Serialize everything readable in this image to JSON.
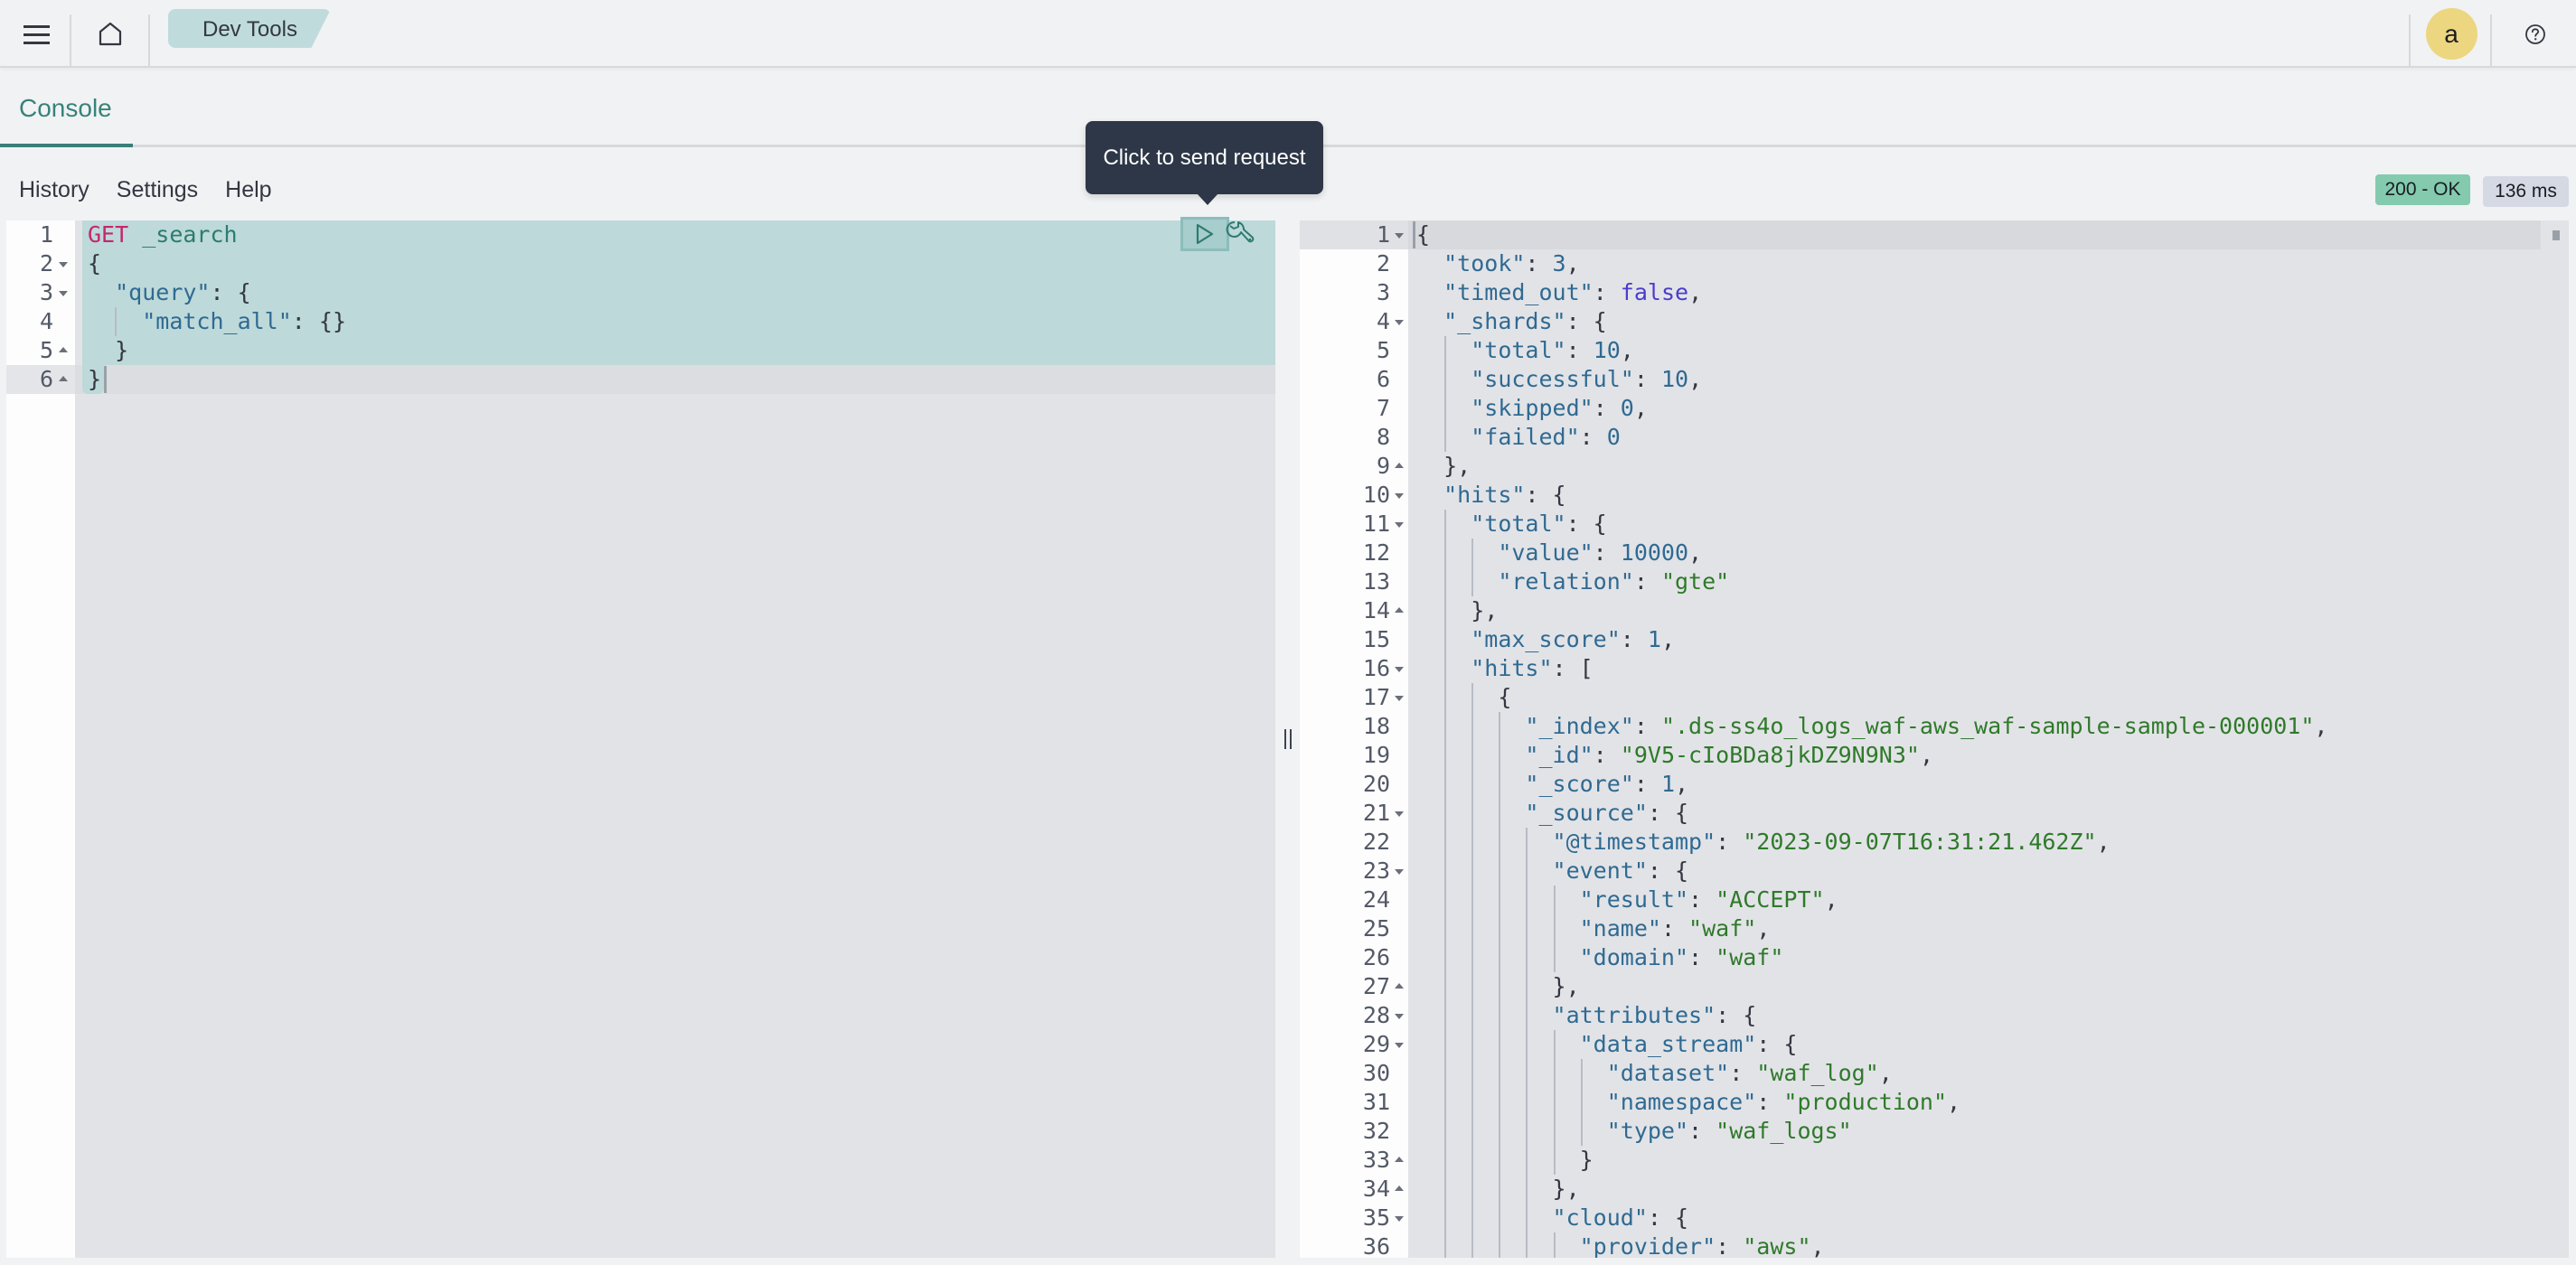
{
  "header": {
    "menu_icon": "hamburger-menu-icon",
    "home_icon": "home-icon",
    "breadcrumb": "Dev Tools",
    "avatar_initial": "a",
    "help_icon": "question-circle-icon"
  },
  "tabs": [
    {
      "label": "Console",
      "active": true
    }
  ],
  "toolbar": {
    "history": "History",
    "settings": "Settings",
    "help": "Help"
  },
  "response_status": {
    "status": "200 - OK",
    "status_color": "#83caaf",
    "time": "136 ms"
  },
  "tooltip": {
    "text": "Click to send request"
  },
  "request_actions": {
    "send_icon": "play-icon",
    "settings_icon": "wrench-icon"
  },
  "request_editor": {
    "active_line": 6,
    "lines": [
      {
        "n": "1",
        "fold": "",
        "indent": 0,
        "tokens": [
          [
            "kw",
            "GET"
          ],
          [
            "punc",
            " "
          ],
          [
            "path",
            "_search"
          ]
        ]
      },
      {
        "n": "2",
        "fold": "down",
        "indent": 0,
        "tokens": [
          [
            "punc",
            "{"
          ]
        ]
      },
      {
        "n": "3",
        "fold": "down",
        "indent": 1,
        "tokens": [
          [
            "key",
            "\"query\""
          ],
          [
            "punc",
            ": {"
          ]
        ]
      },
      {
        "n": "4",
        "fold": "",
        "indent": 2,
        "tokens": [
          [
            "key",
            "\"match_all\""
          ],
          [
            "punc",
            ": {}"
          ]
        ]
      },
      {
        "n": "5",
        "fold": "up",
        "indent": 1,
        "tokens": [
          [
            "punc",
            "}"
          ]
        ]
      },
      {
        "n": "6",
        "fold": "up",
        "indent": 0,
        "tokens": [
          [
            "punc",
            "}"
          ]
        ]
      }
    ]
  },
  "response_output": {
    "active_line": 1,
    "lines": [
      {
        "n": "1",
        "fold": "down",
        "indent": 0,
        "tokens": [
          [
            "punc",
            "{"
          ]
        ]
      },
      {
        "n": "2",
        "fold": "",
        "indent": 1,
        "tokens": [
          [
            "key",
            "\"took\""
          ],
          [
            "punc",
            ": "
          ],
          [
            "num",
            "3"
          ],
          [
            "punc",
            ","
          ]
        ]
      },
      {
        "n": "3",
        "fold": "",
        "indent": 1,
        "tokens": [
          [
            "key",
            "\"timed_out\""
          ],
          [
            "punc",
            ": "
          ],
          [
            "bool",
            "false"
          ],
          [
            "punc",
            ","
          ]
        ]
      },
      {
        "n": "4",
        "fold": "down",
        "indent": 1,
        "tokens": [
          [
            "key",
            "\"_shards\""
          ],
          [
            "punc",
            ": {"
          ]
        ]
      },
      {
        "n": "5",
        "fold": "",
        "indent": 2,
        "tokens": [
          [
            "key",
            "\"total\""
          ],
          [
            "punc",
            ": "
          ],
          [
            "num",
            "10"
          ],
          [
            "punc",
            ","
          ]
        ]
      },
      {
        "n": "6",
        "fold": "",
        "indent": 2,
        "tokens": [
          [
            "key",
            "\"successful\""
          ],
          [
            "punc",
            ": "
          ],
          [
            "num",
            "10"
          ],
          [
            "punc",
            ","
          ]
        ]
      },
      {
        "n": "7",
        "fold": "",
        "indent": 2,
        "tokens": [
          [
            "key",
            "\"skipped\""
          ],
          [
            "punc",
            ": "
          ],
          [
            "num",
            "0"
          ],
          [
            "punc",
            ","
          ]
        ]
      },
      {
        "n": "8",
        "fold": "",
        "indent": 2,
        "tokens": [
          [
            "key",
            "\"failed\""
          ],
          [
            "punc",
            ": "
          ],
          [
            "num",
            "0"
          ]
        ]
      },
      {
        "n": "9",
        "fold": "up",
        "indent": 1,
        "tokens": [
          [
            "punc",
            "},"
          ]
        ]
      },
      {
        "n": "10",
        "fold": "down",
        "indent": 1,
        "tokens": [
          [
            "key",
            "\"hits\""
          ],
          [
            "punc",
            ": {"
          ]
        ]
      },
      {
        "n": "11",
        "fold": "down",
        "indent": 2,
        "tokens": [
          [
            "key",
            "\"total\""
          ],
          [
            "punc",
            ": {"
          ]
        ]
      },
      {
        "n": "12",
        "fold": "",
        "indent": 3,
        "tokens": [
          [
            "key",
            "\"value\""
          ],
          [
            "punc",
            ": "
          ],
          [
            "num",
            "10000"
          ],
          [
            "punc",
            ","
          ]
        ]
      },
      {
        "n": "13",
        "fold": "",
        "indent": 3,
        "tokens": [
          [
            "key",
            "\"relation\""
          ],
          [
            "punc",
            ": "
          ],
          [
            "str",
            "\"gte\""
          ]
        ]
      },
      {
        "n": "14",
        "fold": "up",
        "indent": 2,
        "tokens": [
          [
            "punc",
            "},"
          ]
        ]
      },
      {
        "n": "15",
        "fold": "",
        "indent": 2,
        "tokens": [
          [
            "key",
            "\"max_score\""
          ],
          [
            "punc",
            ": "
          ],
          [
            "num",
            "1"
          ],
          [
            "punc",
            ","
          ]
        ]
      },
      {
        "n": "16",
        "fold": "down",
        "indent": 2,
        "tokens": [
          [
            "key",
            "\"hits\""
          ],
          [
            "punc",
            ": ["
          ]
        ]
      },
      {
        "n": "17",
        "fold": "down",
        "indent": 3,
        "tokens": [
          [
            "punc",
            "{"
          ]
        ]
      },
      {
        "n": "18",
        "fold": "",
        "indent": 4,
        "tokens": [
          [
            "key",
            "\"_index\""
          ],
          [
            "punc",
            ": "
          ],
          [
            "str",
            "\".ds-ss4o_logs_waf-aws_waf-sample-sample-000001\""
          ],
          [
            "punc",
            ","
          ]
        ]
      },
      {
        "n": "19",
        "fold": "",
        "indent": 4,
        "tokens": [
          [
            "key",
            "\"_id\""
          ],
          [
            "punc",
            ": "
          ],
          [
            "str",
            "\"9V5-cIoBDa8jkDZ9N9N3\""
          ],
          [
            "punc",
            ","
          ]
        ]
      },
      {
        "n": "20",
        "fold": "",
        "indent": 4,
        "tokens": [
          [
            "key",
            "\"_score\""
          ],
          [
            "punc",
            ": "
          ],
          [
            "num",
            "1"
          ],
          [
            "punc",
            ","
          ]
        ]
      },
      {
        "n": "21",
        "fold": "down",
        "indent": 4,
        "tokens": [
          [
            "key",
            "\"_source\""
          ],
          [
            "punc",
            ": {"
          ]
        ]
      },
      {
        "n": "22",
        "fold": "",
        "indent": 5,
        "tokens": [
          [
            "key",
            "\"@timestamp\""
          ],
          [
            "punc",
            ": "
          ],
          [
            "str",
            "\"2023-09-07T16:31:21.462Z\""
          ],
          [
            "punc",
            ","
          ]
        ]
      },
      {
        "n": "23",
        "fold": "down",
        "indent": 5,
        "tokens": [
          [
            "key",
            "\"event\""
          ],
          [
            "punc",
            ": {"
          ]
        ]
      },
      {
        "n": "24",
        "fold": "",
        "indent": 6,
        "tokens": [
          [
            "key",
            "\"result\""
          ],
          [
            "punc",
            ": "
          ],
          [
            "str",
            "\"ACCEPT\""
          ],
          [
            "punc",
            ","
          ]
        ]
      },
      {
        "n": "25",
        "fold": "",
        "indent": 6,
        "tokens": [
          [
            "key",
            "\"name\""
          ],
          [
            "punc",
            ": "
          ],
          [
            "str",
            "\"waf\""
          ],
          [
            "punc",
            ","
          ]
        ]
      },
      {
        "n": "26",
        "fold": "",
        "indent": 6,
        "tokens": [
          [
            "key",
            "\"domain\""
          ],
          [
            "punc",
            ": "
          ],
          [
            "str",
            "\"waf\""
          ]
        ]
      },
      {
        "n": "27",
        "fold": "up",
        "indent": 5,
        "tokens": [
          [
            "punc",
            "},"
          ]
        ]
      },
      {
        "n": "28",
        "fold": "down",
        "indent": 5,
        "tokens": [
          [
            "key",
            "\"attributes\""
          ],
          [
            "punc",
            ": {"
          ]
        ]
      },
      {
        "n": "29",
        "fold": "down",
        "indent": 6,
        "tokens": [
          [
            "key",
            "\"data_stream\""
          ],
          [
            "punc",
            ": {"
          ]
        ]
      },
      {
        "n": "30",
        "fold": "",
        "indent": 7,
        "tokens": [
          [
            "key",
            "\"dataset\""
          ],
          [
            "punc",
            ": "
          ],
          [
            "str",
            "\"waf_log\""
          ],
          [
            "punc",
            ","
          ]
        ]
      },
      {
        "n": "31",
        "fold": "",
        "indent": 7,
        "tokens": [
          [
            "key",
            "\"namespace\""
          ],
          [
            "punc",
            ": "
          ],
          [
            "str",
            "\"production\""
          ],
          [
            "punc",
            ","
          ]
        ]
      },
      {
        "n": "32",
        "fold": "",
        "indent": 7,
        "tokens": [
          [
            "key",
            "\"type\""
          ],
          [
            "punc",
            ": "
          ],
          [
            "str",
            "\"waf_logs\""
          ]
        ]
      },
      {
        "n": "33",
        "fold": "up",
        "indent": 6,
        "tokens": [
          [
            "punc",
            "}"
          ]
        ]
      },
      {
        "n": "34",
        "fold": "up",
        "indent": 5,
        "tokens": [
          [
            "punc",
            "},"
          ]
        ]
      },
      {
        "n": "35",
        "fold": "down",
        "indent": 5,
        "tokens": [
          [
            "key",
            "\"cloud\""
          ],
          [
            "punc",
            ": {"
          ]
        ]
      },
      {
        "n": "36",
        "fold": "",
        "indent": 6,
        "tokens": [
          [
            "key",
            "\"provider\""
          ],
          [
            "punc",
            ": "
          ],
          [
            "str",
            "\"aws\""
          ],
          [
            "punc",
            ","
          ]
        ]
      }
    ]
  }
}
